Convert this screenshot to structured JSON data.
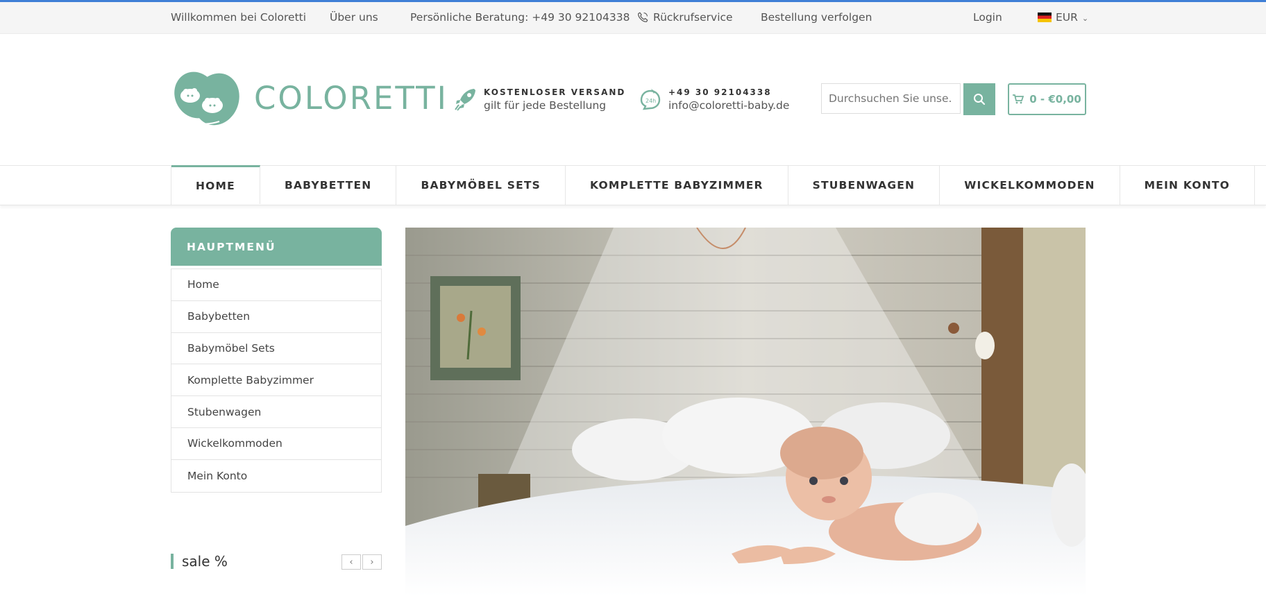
{
  "topbar": {
    "welcome": "Willkommen bei Coloretti",
    "about": "Über uns",
    "consult": "Persönliche Beratung: +49 30 92104338",
    "callback": "Rückrufservice",
    "track": "Bestellung verfolgen",
    "login": "Login",
    "currency": "EUR"
  },
  "header": {
    "logo_text": "COLORETTI",
    "shipping_title": "KOSTENLOSER VERSAND",
    "shipping_sub": "gilt für jede Bestellung",
    "contact_phone": "+49 30 92104338",
    "contact_email": "info@coloretti-baby.de",
    "search_placeholder": "Durchsuchen Sie unse...",
    "cart_label": "0 - €0,00"
  },
  "nav": {
    "items": [
      "HOME",
      "BABYBETTEN",
      "BABYMÖBEL SETS",
      "KOMPLETTE BABYZIMMER",
      "STUBENWAGEN",
      "WICKELKOMMODEN",
      "MEIN KONTO"
    ]
  },
  "sidebar": {
    "title": "HAUPTMENÜ",
    "items": [
      "Home",
      "Babybetten",
      "Babymöbel Sets",
      "Komplette Babyzimmer",
      "Stubenwagen",
      "Wickelkommoden",
      "Mein Konto"
    ],
    "sale_title": "sale %"
  },
  "colors": {
    "accent": "#78b39f",
    "topline": "#3f7fd6"
  },
  "icons": [
    "phone-icon",
    "rocket-icon",
    "support-icon",
    "search-icon",
    "cart-icon",
    "germany-flag-icon",
    "chevron-down-icon",
    "chevron-left-icon",
    "chevron-right-icon"
  ]
}
